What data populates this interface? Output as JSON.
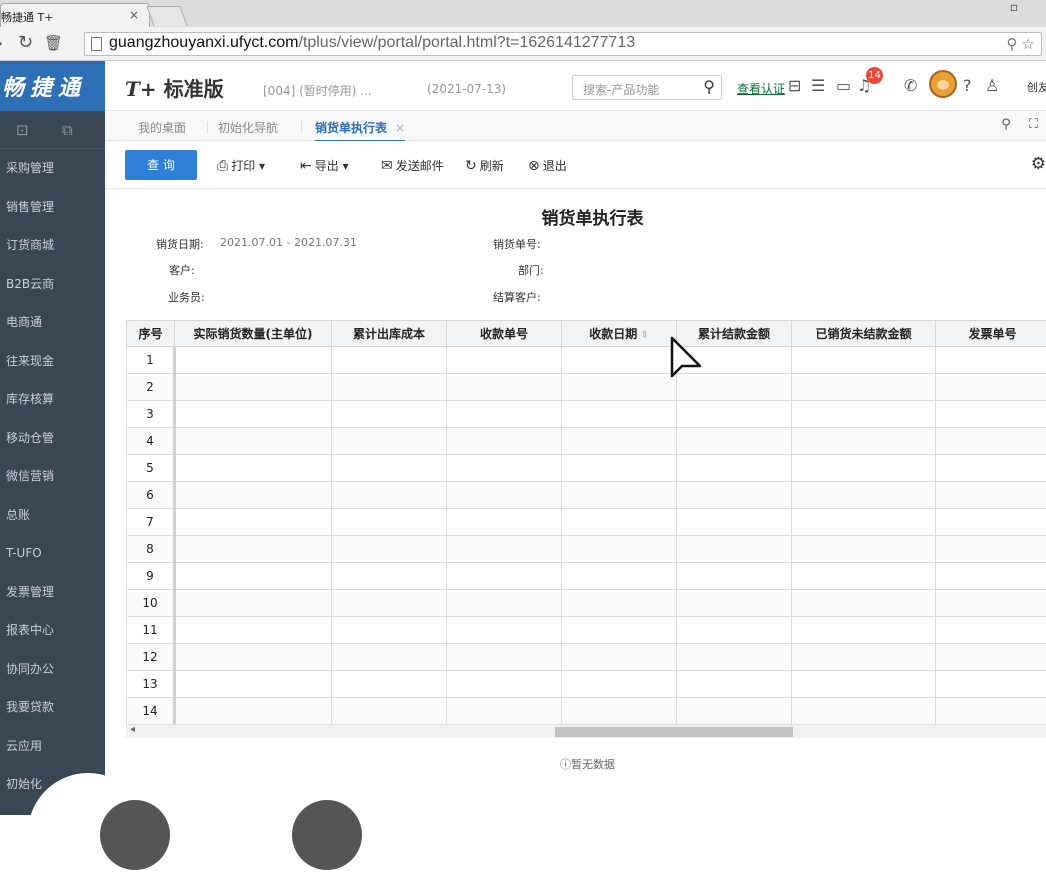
{
  "browser": {
    "tab_title": "畅捷通 T+",
    "tab_close": "×",
    "url_host": "guangzhouyanxi.ufyct.com",
    "url_path": "/tplus/view/portal/portal.html?t=1626141277713"
  },
  "sidebar": {
    "brand": "畅捷通",
    "items": [
      {
        "label": "采购管理"
      },
      {
        "label": "销售管理"
      },
      {
        "label": "订货商城"
      },
      {
        "label": "B2B云商"
      },
      {
        "label": "电商通"
      },
      {
        "label": "往来现金"
      },
      {
        "label": "库存核算"
      },
      {
        "label": "移动仓管"
      },
      {
        "label": "微信营销"
      },
      {
        "label": "总账"
      },
      {
        "label": "T-UFO"
      },
      {
        "label": "发票管理"
      },
      {
        "label": "报表中心"
      },
      {
        "label": "协同办公"
      },
      {
        "label": "我要贷款"
      },
      {
        "label": "云应用"
      },
      {
        "label": "初始化"
      }
    ]
  },
  "header": {
    "logo_mark": "T+",
    "logo_text": "标准版",
    "account": "[004] (暂时停用) ...",
    "date": "(2021-07-13)",
    "search_placeholder": "搜索-产品功能",
    "auth_link": "查看认证",
    "notify_count": "14",
    "user_name": "创友"
  },
  "page_tabs": [
    {
      "label": "我的桌面"
    },
    {
      "label": "初始化导航"
    },
    {
      "label": "销货单执行表",
      "close": "×"
    }
  ],
  "toolbar": {
    "query": "查 询",
    "print": "打印",
    "export": "导出",
    "send_mail": "发送邮件",
    "refresh": "刷新",
    "exit": "退出"
  },
  "report": {
    "title": "销货单执行表",
    "filters": {
      "date_label": "销货日期:",
      "date_value": "2021.07.01 - 2021.07.31",
      "order_no_label": "销货单号:",
      "customer_label": "客户:",
      "dept_label": "部门:",
      "salesman_label": "业务员:",
      "settle_customer_label": "结算客户:"
    },
    "columns": [
      "序号",
      "实际销货数量(主单位)",
      "累计出库成本",
      "收款单号",
      "收款日期",
      "累计结款金额",
      "已销货未结款金额",
      "发票单号"
    ],
    "rows": [
      "1",
      "2",
      "3",
      "4",
      "5",
      "6",
      "7",
      "8",
      "9",
      "10",
      "11",
      "12",
      "13",
      "14"
    ],
    "empty_tip": "暂无数据"
  },
  "colors": {
    "sidebar_bg": "#3b4654",
    "brand_bg": "#2f6fb5",
    "primary_button": "#2f7fd8",
    "badge": "#e8493b"
  }
}
